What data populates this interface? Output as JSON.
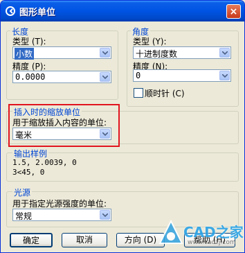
{
  "window": {
    "title": "图形单位",
    "close_glyph": "×"
  },
  "length": {
    "group_label": "长度",
    "type_label": "类型 (T):",
    "type_value": "小数",
    "precision_label": "精度 (P):",
    "precision_value": "0.0000"
  },
  "angle": {
    "group_label": "角度",
    "type_label": "类型 (Y):",
    "type_value": "十进制度数",
    "precision_label": "精度 (N):",
    "precision_value": "0",
    "clockwise_label": "顺时针 (C)",
    "clockwise_checked": false
  },
  "insert_scale": {
    "group_label": "插入时的缩放单位",
    "desc": "用于缩放插入内容的单位:",
    "value": "毫米"
  },
  "sample_output": {
    "group_label": "输出样例",
    "line1": "1.5, 2.0039, 0",
    "line2": "3<45, 0"
  },
  "lighting": {
    "group_label": "光源",
    "desc": "用于指定光源强度的单位:",
    "value": "常规"
  },
  "buttons": {
    "ok": "确定",
    "cancel": "取消",
    "direction": "方向 (D)",
    "help": "帮助 (H)"
  },
  "watermark": {
    "text": "CAD之家",
    "url": "www.cadzj.com"
  },
  "colors": {
    "title_bar": "#0054e3",
    "group_label": "#0046d5",
    "highlight_box": "#e0141e"
  }
}
